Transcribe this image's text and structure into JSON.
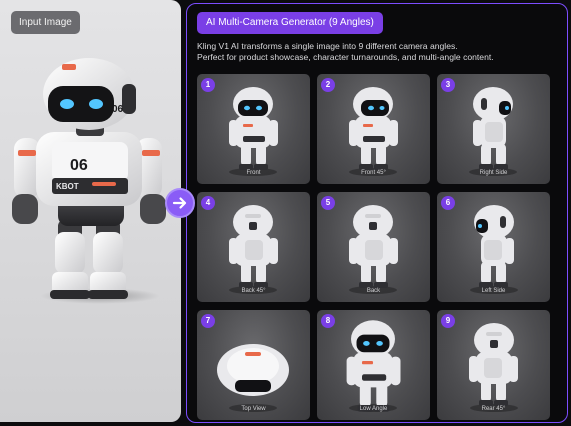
{
  "input": {
    "label": "Input Image"
  },
  "header": {
    "title": "AI Multi-Camera Generator (9 Angles)",
    "description_lines": [
      "Kling V1 AI transforms a single image into 9 different camera angles.",
      "Perfect for product showcase, character turnarounds, and multi-angle content."
    ]
  },
  "robot_badge": {
    "chest": "06",
    "side": "06",
    "belt": "KBOT"
  },
  "views": [
    {
      "num": "1",
      "label": "Front"
    },
    {
      "num": "2",
      "label": "Front 45°"
    },
    {
      "num": "3",
      "label": "Right Side"
    },
    {
      "num": "4",
      "label": "Back 45°"
    },
    {
      "num": "5",
      "label": "Back"
    },
    {
      "num": "6",
      "label": "Left Side"
    },
    {
      "num": "7",
      "label": "Top View"
    },
    {
      "num": "8",
      "label": "Low Angle"
    },
    {
      "num": "9",
      "label": "Rear 45°"
    }
  ],
  "colors": {
    "accent": "#7a3fe6",
    "border": "#7c4dff",
    "visor_glow": "#53c6ff"
  },
  "icons": {
    "arrow": "arrow-right-icon"
  }
}
